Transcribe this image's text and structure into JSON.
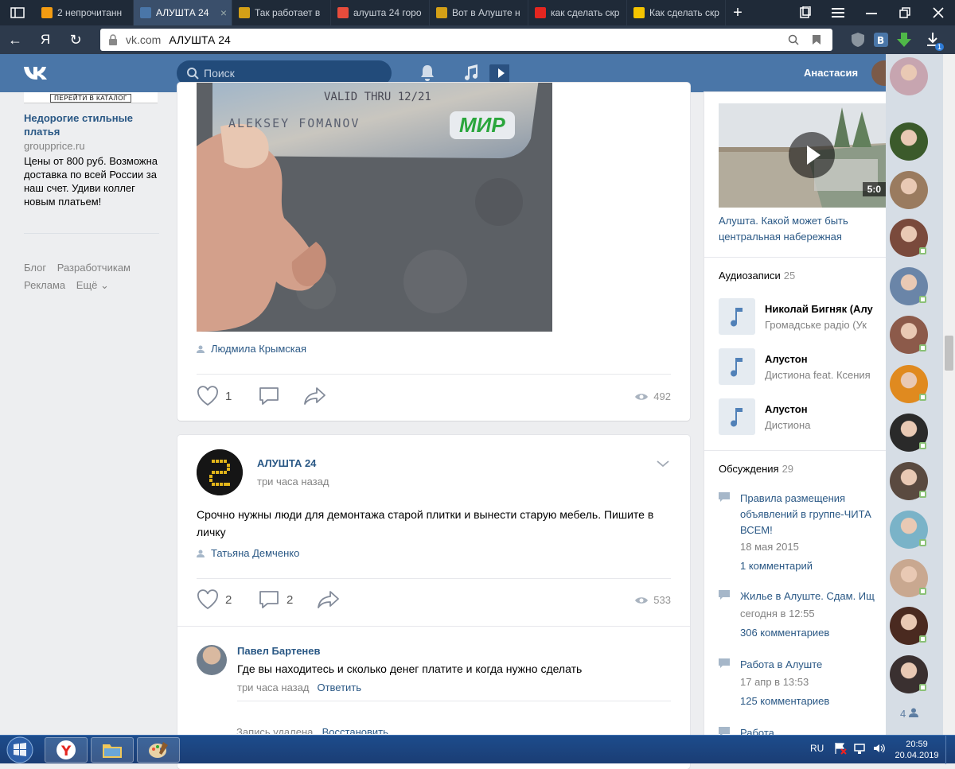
{
  "browser": {
    "tabs": [
      {
        "label": "2 непрочитанн",
        "color": "#f39c12"
      },
      {
        "label": "АЛУШТА 24",
        "color": "#4a76a8",
        "active": true
      },
      {
        "label": "Так работает в",
        "color": "#d4a017"
      },
      {
        "label": "алушта 24 горо",
        "color": "#e74c3c"
      },
      {
        "label": "Вот в Алуште н",
        "color": "#d4a017"
      },
      {
        "label": "как сделать скр",
        "color": "#e52620"
      },
      {
        "label": "Как сделать скр",
        "color": "#f5c400"
      }
    ],
    "tab_close": "×",
    "new_tab": "+",
    "address": {
      "domain": "vk.com",
      "page_title": "АЛУШТА 24"
    },
    "yandex_letter": "Я",
    "badge_count": "1"
  },
  "vk": {
    "logo": "VK",
    "search_placeholder": "Поиск",
    "user_name": "Анастасия"
  },
  "left": {
    "ad_catalog_button": "ПЕРЕЙТИ В КАТАЛОГ",
    "ad_title": "Недорогие стильные платья",
    "ad_domain": "groupprice.ru",
    "ad_text": "Цены от 800 руб. Возможна доставка по всей России за наш счет. Удиви коллег новым платьем!",
    "links": [
      "Блог",
      "Разработчикам",
      "Реклама",
      "Ещё ⌄"
    ]
  },
  "post1": {
    "card_text_1": "VALID THRU 12/21",
    "card_name": "ALEKSEY FOMANOV",
    "card_logo": "МИР",
    "author": "Людмила Крымская",
    "likes": "1",
    "comments": "",
    "views": "492"
  },
  "post2": {
    "group": "АЛУШТА 24",
    "time": "три часа назад",
    "text": "Срочно нужны люди для демонтажа старой плитки и вынести старую мебель. Пишите в личку",
    "author": "Татьяна Демченко",
    "likes": "2",
    "comments": "2",
    "views": "533",
    "comment": {
      "name": "Павел Бартенев",
      "text": "Где вы находитесь и сколько денег платите и когда нужно сделать",
      "time": "три часа назад",
      "reply": "Ответить"
    },
    "deleted_text": "Запись удалена.",
    "restore": "Восстановить"
  },
  "right": {
    "video_duration": "5:0",
    "video_title": "Алушта. Какой может быть центральная набережная",
    "audio_title": "Аудиозаписи",
    "audio_count": "25",
    "tracks": [
      {
        "title": "Николай Бигняк (Алу",
        "artist": "Громадське радіо (Ук"
      },
      {
        "title": "Алустон",
        "artist": "Дистиона feat. Ксения"
      },
      {
        "title": "Алустон",
        "artist": "Дистиона"
      }
    ],
    "disc_title": "Обсуждения",
    "disc_count": "29",
    "discussions": [
      {
        "title": "Правила размещения объявлений в группе-ЧИТА ВСЕМ!",
        "date": "18 мая 2015",
        "comments": "1 комментарий"
      },
      {
        "title": "Жилье в Алуште. Сдам. Ищ",
        "date": "сегодня в 12:55",
        "comments": "306 комментариев"
      },
      {
        "title": "Работа в Алуште",
        "date": "17 апр в 13:53",
        "comments": "125 комментариев"
      },
      {
        "title": "Работа",
        "date": "",
        "comments": ""
      }
    ]
  },
  "friends": {
    "count": "4",
    "colors": [
      "#c7a5b0",
      "#3b5a2b",
      "#9a7b5f",
      "#7a4a3c",
      "#6a85a8",
      "#8c5a4a",
      "#e08a1f",
      "#2a2a2a",
      "#5a4a40",
      "#7ab3c8",
      "#c9a890",
      "#4a2a20",
      "#3a3030"
    ]
  },
  "taskbar": {
    "lang": "RU",
    "time": "20:59",
    "date": "20.04.2019"
  }
}
